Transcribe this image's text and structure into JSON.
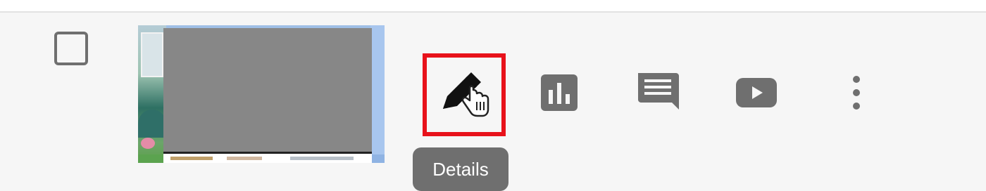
{
  "row": {
    "checkbox": {
      "checked": false
    },
    "thumbnail": {
      "redacted": true
    }
  },
  "actions": [
    {
      "name": "details",
      "icon": "pencil-icon",
      "highlighted": true
    },
    {
      "name": "analytics",
      "icon": "bar-chart-icon"
    },
    {
      "name": "comments",
      "icon": "comment-icon"
    },
    {
      "name": "view-on-youtube",
      "icon": "youtube-play-icon"
    },
    {
      "name": "options",
      "icon": "more-vertical-icon"
    }
  ],
  "tooltip": {
    "text": "Details"
  },
  "colors": {
    "highlight": "#e8121b",
    "icon": "#6f6f6f",
    "tooltip_bg": "#6f6f6f",
    "background": "#f6f6f6"
  }
}
